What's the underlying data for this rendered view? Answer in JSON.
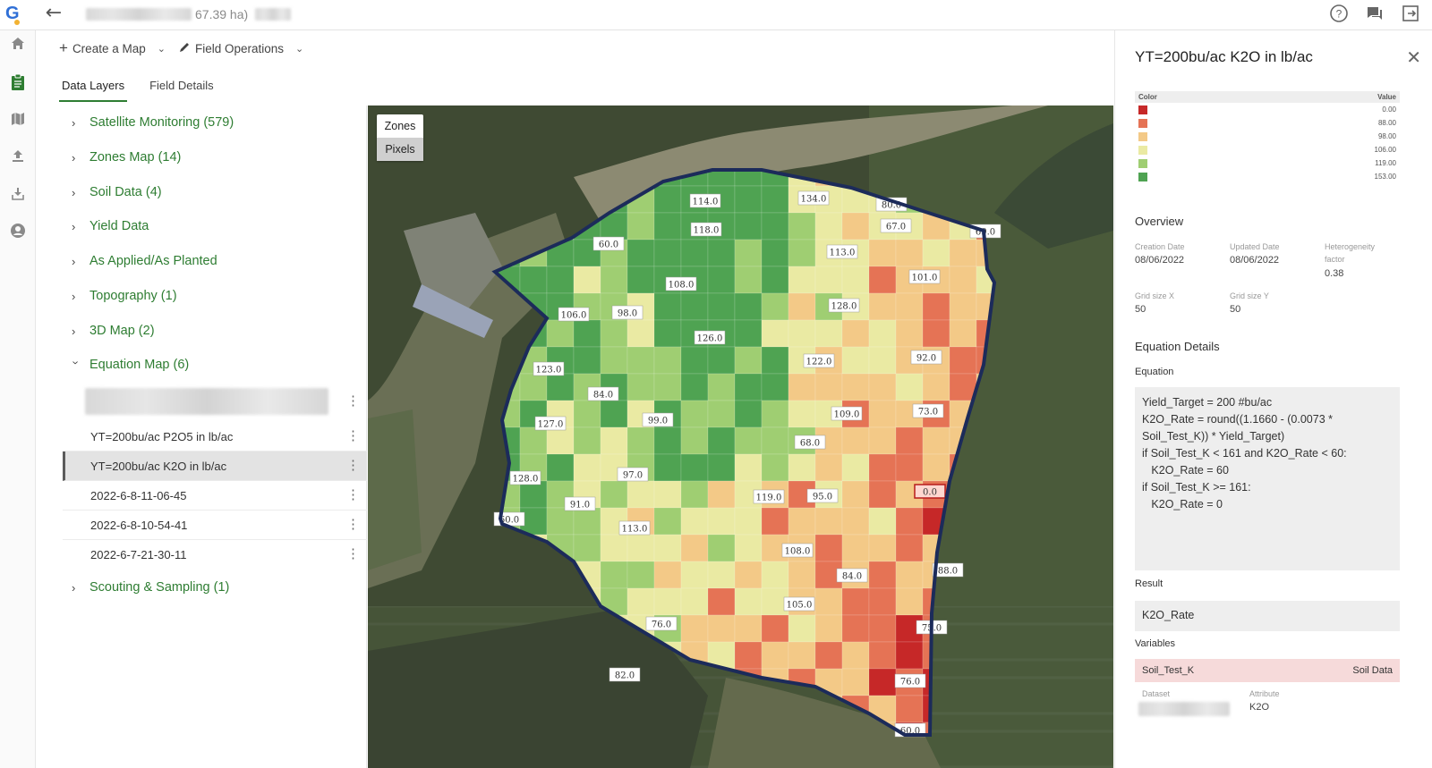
{
  "header": {
    "field_area": "67.39 ha)"
  },
  "toolbar": {
    "create_map": "Create a Map",
    "field_operations": "Field Operations"
  },
  "tabs": [
    "Data Layers",
    "Field Details"
  ],
  "layers": {
    "groups": [
      "Satellite Monitoring (579)",
      "Zones Map (14)",
      "Soil Data (4)",
      "Yield Data",
      "As Applied/As Planted",
      "Topography (1)",
      "3D Map (2)",
      "Equation Map (6)",
      "Scouting & Sampling (1)"
    ],
    "equation_items": [
      "YT=200bu/ac P2O5 in lb/ac",
      "YT=200bu/ac K2O in lb/ac",
      "2022-6-8-11-06-45",
      "2022-6-8-10-54-41",
      "2022-6-7-21-30-11"
    ]
  },
  "map": {
    "toggle": [
      "Zones",
      "Pixels"
    ],
    "cell_labels": [
      "114.0",
      "134.0",
      "118.0",
      "80.0",
      "67.0",
      "69.0",
      "60.0",
      "113.0",
      "108.0",
      "101.0",
      "106.0",
      "98.0",
      "128.0",
      "126.0",
      "123.0",
      "122.0",
      "92.0",
      "84.0",
      "99.0",
      "109.0",
      "73.0",
      "127.0",
      "68.0",
      "128.0",
      "97.0",
      "0.0",
      "91.0",
      "119.0",
      "95.0",
      "60.0",
      "113.0",
      "108.0",
      "84.0",
      "88.0",
      "105.0",
      "76.0",
      "75.0",
      "76.0",
      "82.0",
      "60.0"
    ]
  },
  "panel": {
    "title": "YT=200bu/ac K2O in lb/ac",
    "legend": {
      "col_color": "Color",
      "col_value": "Value",
      "rows": [
        {
          "color": "#c62828",
          "value": "0.00"
        },
        {
          "color": "#e57355",
          "value": "88.00"
        },
        {
          "color": "#f3c987",
          "value": "98.00"
        },
        {
          "color": "#eaeaa3",
          "value": "106.00"
        },
        {
          "color": "#9fce72",
          "value": "119.00"
        },
        {
          "color": "#4fa352",
          "value": "153.00"
        }
      ]
    },
    "overview": {
      "heading": "Overview",
      "creation_label": "Creation Date",
      "creation_value": "08/06/2022",
      "updated_label": "Updated Date",
      "updated_value": "08/06/2022",
      "heterogeneity_label_1": "Heterogeneity",
      "heterogeneity_label_2": "factor",
      "heterogeneity_value": "0.38",
      "grid_x_label": "Grid size X",
      "grid_x_value": "50",
      "grid_y_label": "Grid size Y",
      "grid_y_value": "50"
    },
    "equation_details": {
      "heading": "Equation Details",
      "equation_label": "Equation",
      "lines": [
        "Yield_Target = 200 #bu/ac",
        "",
        "K2O_Rate = round((1.1660 - (0.0073 *",
        "Soil_Test_K)) * Yield_Target)",
        "",
        "if Soil_Test_K < 161 and K2O_Rate < 60:",
        "   K2O_Rate = 60",
        "",
        "if Soil_Test_K >= 161:",
        "   K2O_Rate = 0"
      ],
      "result_label": "Result",
      "result_value": "K2O_Rate",
      "variables_label": "Variables",
      "variable_name": "Soil_Test_K",
      "variable_source": "Soil Data",
      "dataset_label": "Dataset",
      "attribute_label": "Attribute",
      "attribute_value": "K2O"
    }
  }
}
